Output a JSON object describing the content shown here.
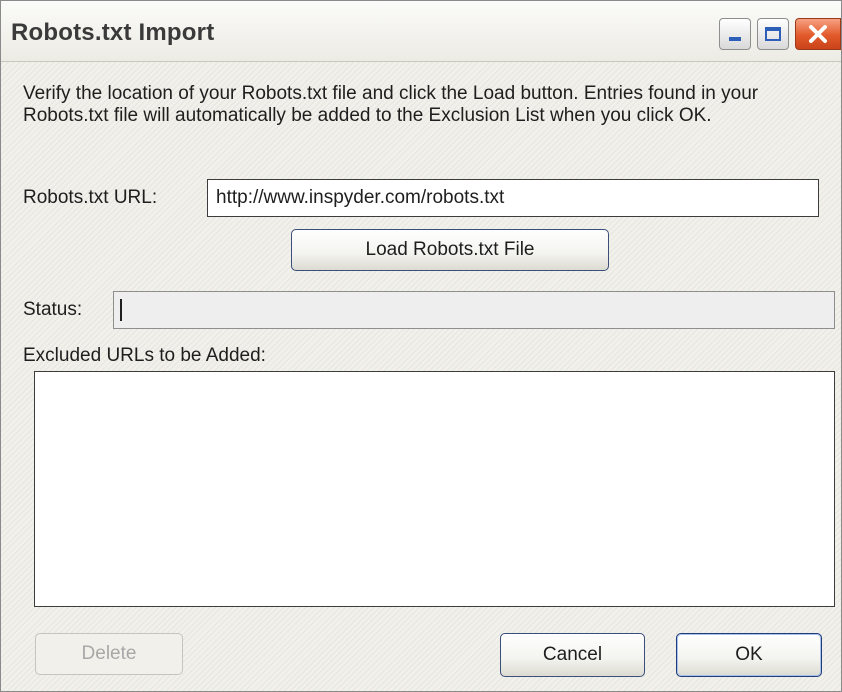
{
  "window": {
    "title": "Robots.txt Import",
    "controls": {
      "minimize": "minimize-icon",
      "maximize": "maximize-icon",
      "close": "close-icon"
    }
  },
  "description": "Verify the location of your Robots.txt file and click the Load button. Entries found in your Robots.txt file will automatically be added to the Exclusion List when you click OK.",
  "url": {
    "label": "Robots.txt URL:",
    "value": "http://www.inspyder.com/robots.txt"
  },
  "load_button": {
    "label": "Load Robots.txt File"
  },
  "status": {
    "label": "Status:",
    "value": ""
  },
  "excluded": {
    "label": "Excluded URLs to be Added:",
    "items": []
  },
  "buttons": {
    "delete": {
      "label": "Delete",
      "enabled": false
    },
    "cancel": {
      "label": "Cancel"
    },
    "ok": {
      "label": "OK"
    }
  },
  "colors": {
    "close_button": "#e25a2a",
    "window_bg": "#f1f0ea"
  }
}
